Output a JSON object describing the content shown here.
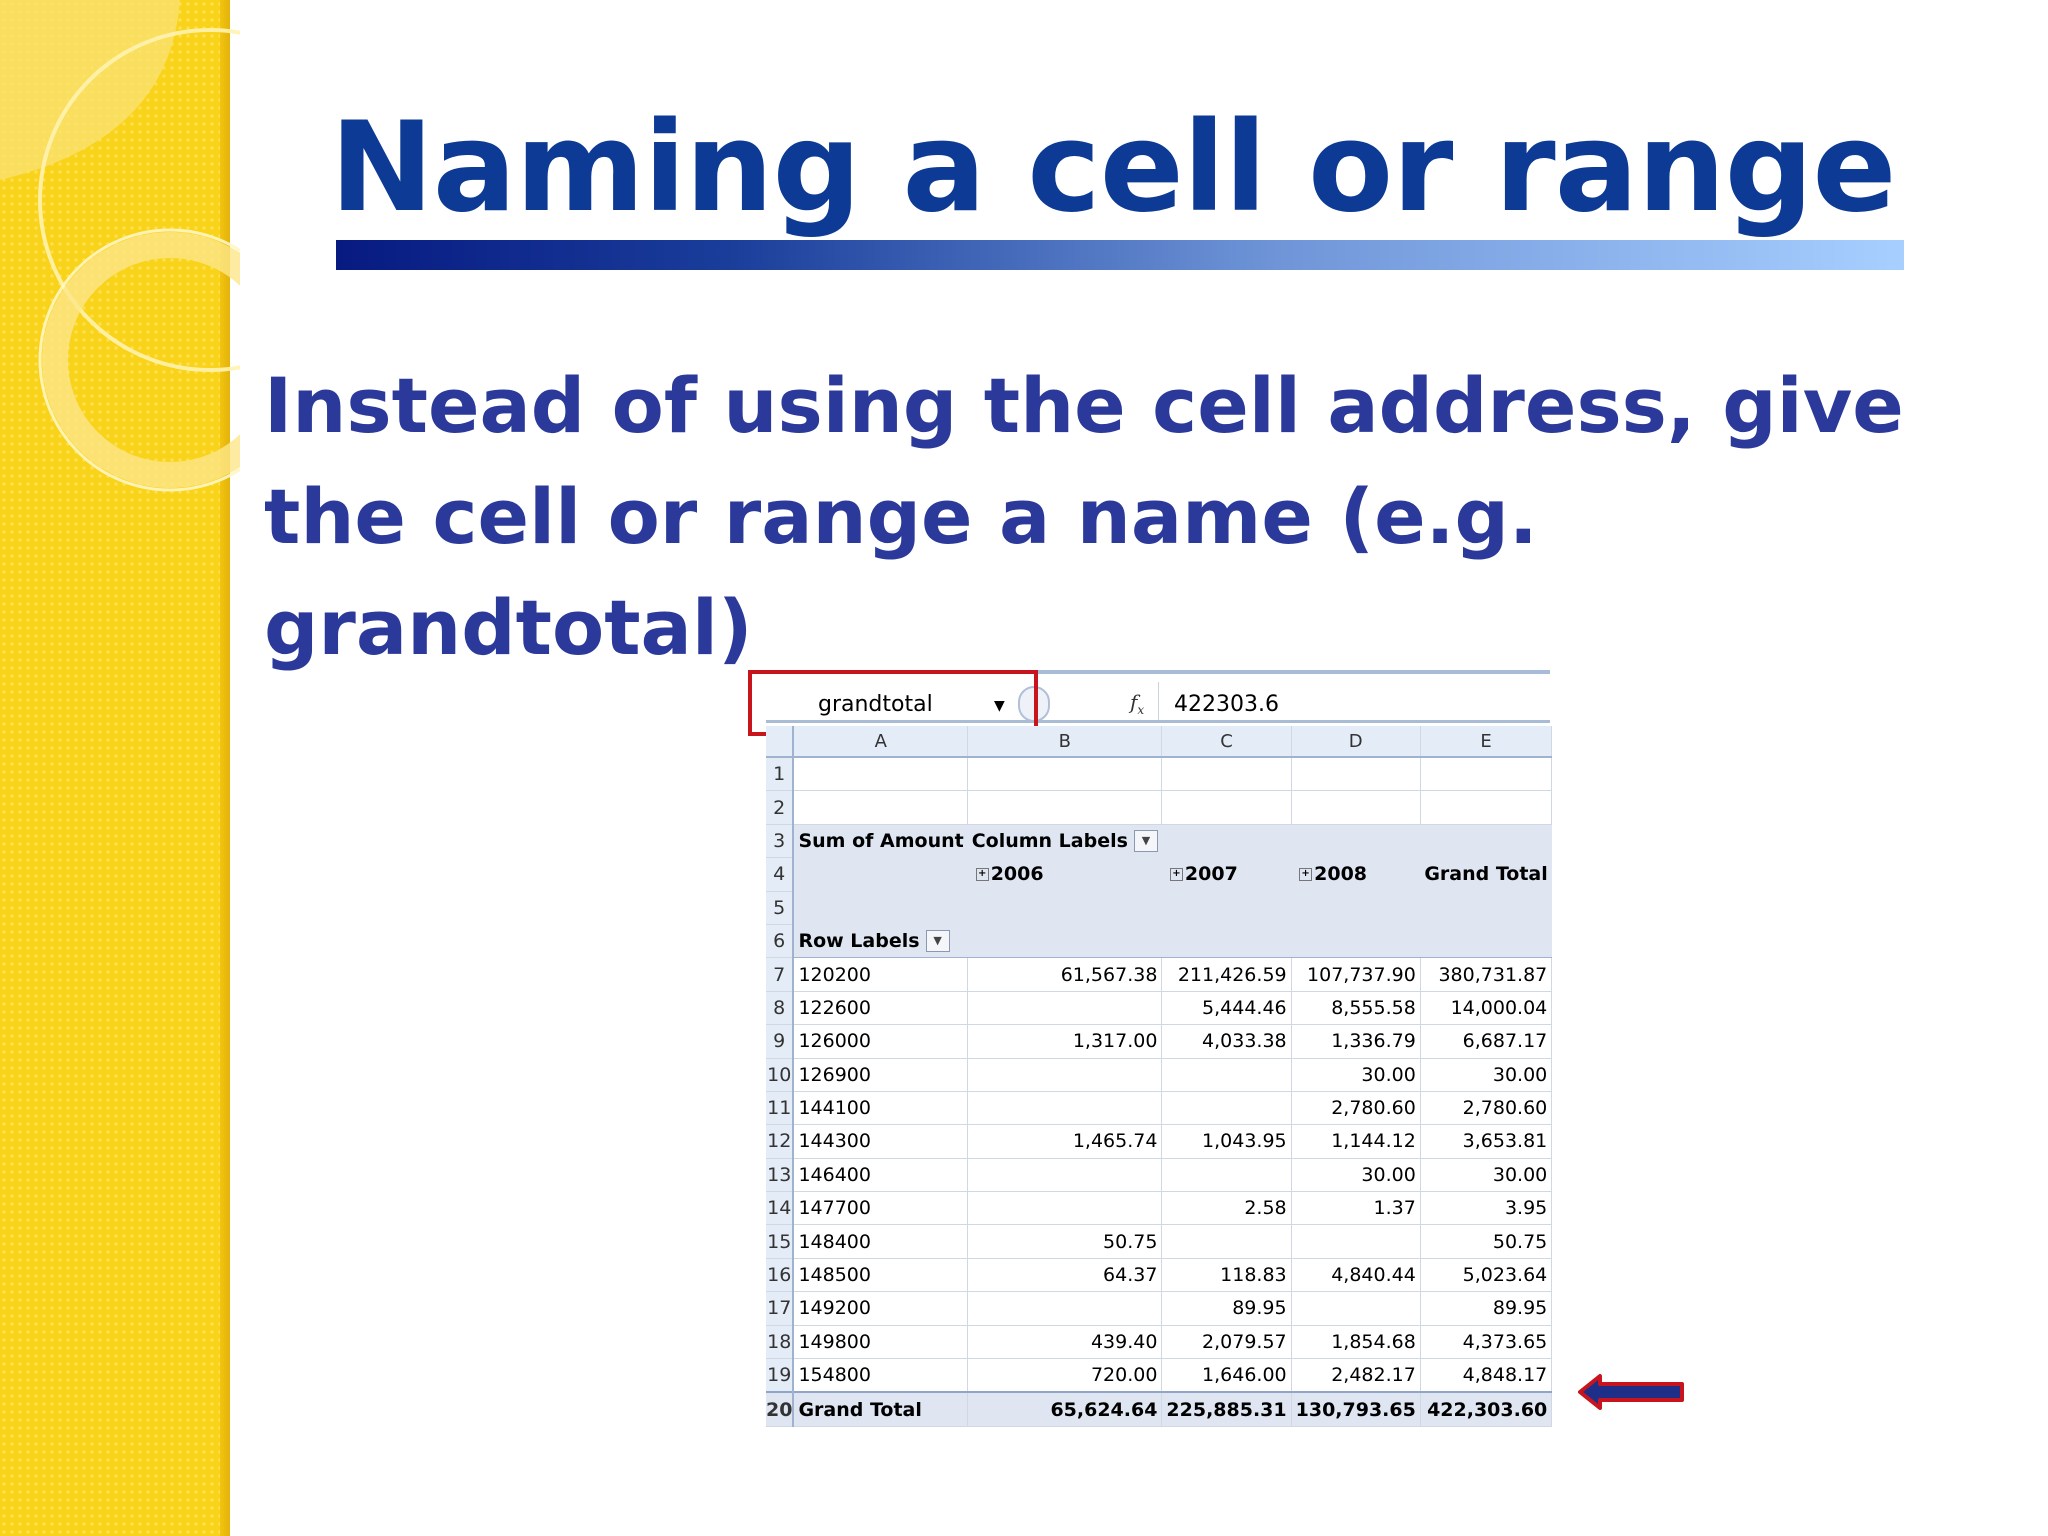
{
  "slide": {
    "title": "Naming a cell or range",
    "subtitle": "Instead of using the cell address, give the cell or range a name (e.g. grandtotal)"
  },
  "formula_bar": {
    "name_box": "grandtotal",
    "fx_label": "fx",
    "value": "422303.6"
  },
  "columns": [
    "A",
    "B",
    "C",
    "D",
    "E"
  ],
  "pivot": {
    "sum_label": "Sum of Amount",
    "column_labels": "Column Labels",
    "row_labels": "Row Labels",
    "years": [
      "2006",
      "2007",
      "2008"
    ],
    "grand_total_header": "Grand Total",
    "rows": [
      {
        "label": "120200",
        "y2006": "61,567.38",
        "y2007": "211,426.59",
        "y2008": "107,737.90",
        "total": "380,731.87"
      },
      {
        "label": "122600",
        "y2006": "",
        "y2007": "5,444.46",
        "y2008": "8,555.58",
        "total": "14,000.04"
      },
      {
        "label": "126000",
        "y2006": "1,317.00",
        "y2007": "4,033.38",
        "y2008": "1,336.79",
        "total": "6,687.17"
      },
      {
        "label": "126900",
        "y2006": "",
        "y2007": "",
        "y2008": "30.00",
        "total": "30.00"
      },
      {
        "label": "144100",
        "y2006": "",
        "y2007": "",
        "y2008": "2,780.60",
        "total": "2,780.60"
      },
      {
        "label": "144300",
        "y2006": "1,465.74",
        "y2007": "1,043.95",
        "y2008": "1,144.12",
        "total": "3,653.81"
      },
      {
        "label": "146400",
        "y2006": "",
        "y2007": "",
        "y2008": "30.00",
        "total": "30.00"
      },
      {
        "label": "147700",
        "y2006": "",
        "y2007": "2.58",
        "y2008": "1.37",
        "total": "3.95"
      },
      {
        "label": "148400",
        "y2006": "50.75",
        "y2007": "",
        "y2008": "",
        "total": "50.75"
      },
      {
        "label": "148500",
        "y2006": "64.37",
        "y2007": "118.83",
        "y2008": "4,840.44",
        "total": "5,023.64"
      },
      {
        "label": "149200",
        "y2006": "",
        "y2007": "89.95",
        "y2008": "",
        "total": "89.95"
      },
      {
        "label": "149800",
        "y2006": "439.40",
        "y2007": "2,079.57",
        "y2008": "1,854.68",
        "total": "4,373.65"
      },
      {
        "label": "154800",
        "y2006": "720.00",
        "y2007": "1,646.00",
        "y2008": "2,482.17",
        "total": "4,848.17"
      }
    ],
    "grand_total_row": {
      "label": "Grand Total",
      "y2006": "65,624.64",
      "y2007": "225,885.31",
      "y2008": "130,793.65",
      "total": "422,303.60"
    }
  },
  "row_numbers": [
    "1",
    "2",
    "3",
    "4",
    "5",
    "6",
    "7",
    "8",
    "9",
    "10",
    "11",
    "12",
    "13",
    "14",
    "15",
    "16",
    "17",
    "18",
    "19",
    "20"
  ],
  "colors": {
    "title": "#0d3a94",
    "subtitle": "#2b3a9a",
    "highlight": "#c8141c",
    "band": "#f9d21a"
  }
}
